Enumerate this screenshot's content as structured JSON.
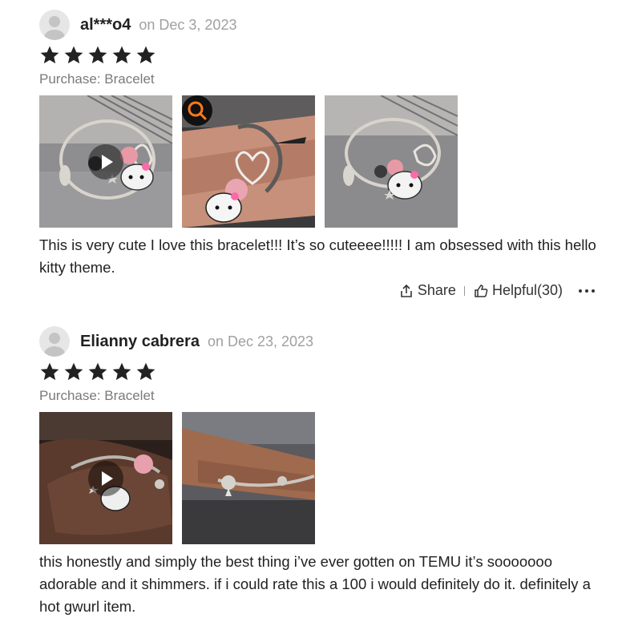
{
  "reviews": [
    {
      "username": "al***o4",
      "date": "on Dec 3, 2023",
      "rating": 5,
      "purchase": "Purchase: Bracelet",
      "media": [
        {
          "kind": "video",
          "icon": "play-icon"
        },
        {
          "kind": "image",
          "icon": "zoom-icon"
        },
        {
          "kind": "image"
        }
      ],
      "text": "This is very cute I love this bracelet!!! It’s so cuteeee!!!!! I am obsessed with this hello kitty theme.",
      "actions": {
        "share_label": "Share",
        "helpful_label": "Helpful(30)",
        "more_icon": "more-icon"
      }
    },
    {
      "username": "Elianny cabrera",
      "date": "on Dec 23, 2023",
      "rating": 5,
      "purchase": "Purchase: Bracelet",
      "media": [
        {
          "kind": "video",
          "icon": "play-icon"
        },
        {
          "kind": "image"
        }
      ],
      "text": "this honestly and simply the best thing i’ve ever gotten on TEMU it’s sooooooo adorable and it shimmers. if i could rate this a 100 i would definitely do it. definitely a hot gwurl item."
    }
  ],
  "colors": {
    "star": "#222222",
    "date_text": "#a0a0a0",
    "purchase_text": "#7a7a7a"
  }
}
